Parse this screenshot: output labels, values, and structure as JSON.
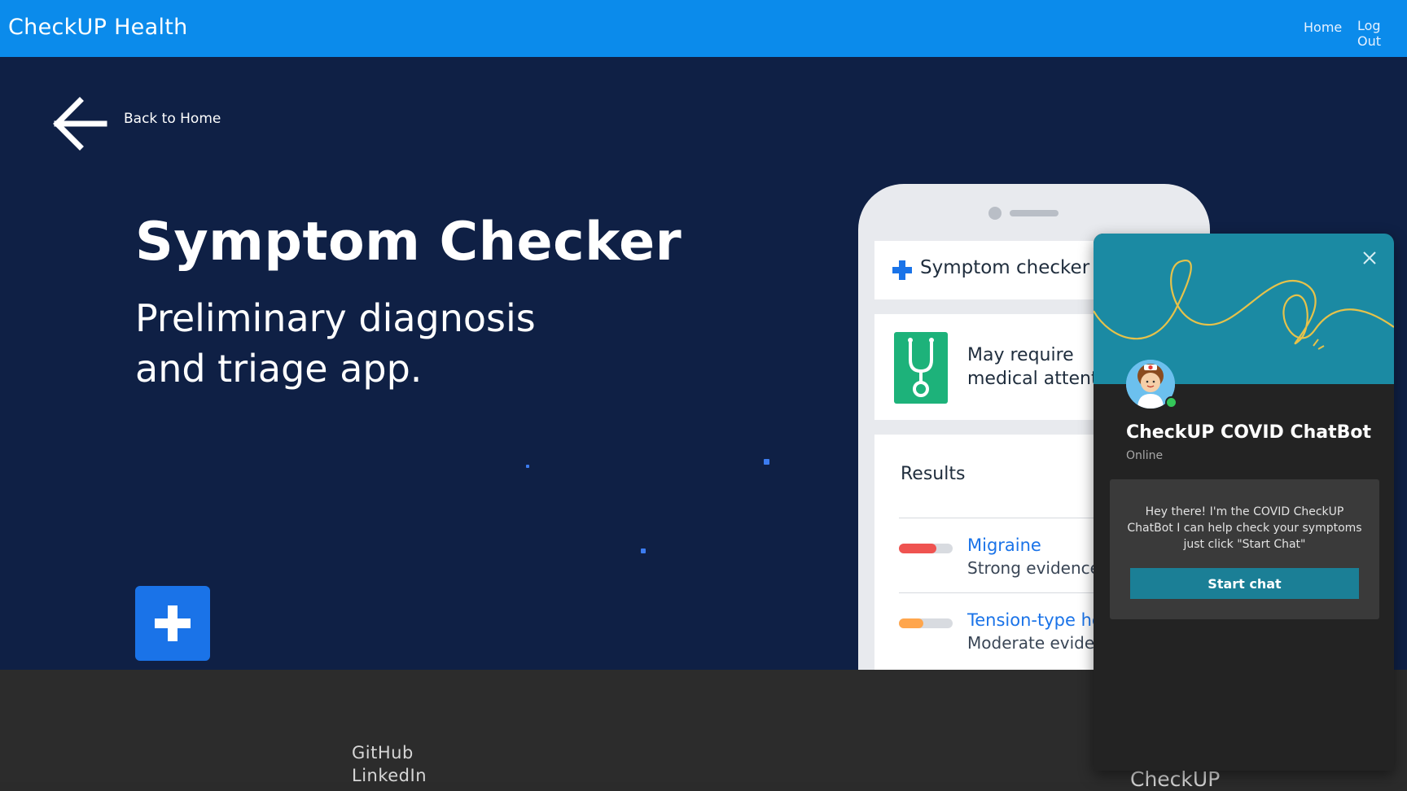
{
  "navbar": {
    "brand": "CheckUP Health",
    "links": [
      "Home",
      "Log Out"
    ],
    "color": "#0b8beb"
  },
  "hero": {
    "back_label": "Back to Home",
    "title": "Symptom Checker",
    "subtitle_line1": "Preliminary diagnosis",
    "subtitle_line2": "and triage app.",
    "background": "#0f2045"
  },
  "phone": {
    "header": "Symptom checker",
    "status_line1": "May require",
    "status_line2": "medical attent",
    "results_heading": "Results",
    "results": [
      {
        "name": "Migraine",
        "evidence": "Strong evidence",
        "color": "#ef5350",
        "level": 0.7
      },
      {
        "name": "Tension-type he",
        "evidence": "Moderate evide",
        "color": "#ffa64d",
        "level": 0.45
      }
    ]
  },
  "footer": {
    "links": [
      "GitHub",
      "LinkedIn"
    ],
    "brand": "CheckUP"
  },
  "chatbot": {
    "name": "CheckUP COVID ChatBot",
    "status": "Online",
    "greeting": "Hey there! I'm the COVID CheckUP ChatBot I can help check your symptoms just click \"Start Chat\"",
    "start_button": "Start chat",
    "accent": "#1b7f96"
  }
}
